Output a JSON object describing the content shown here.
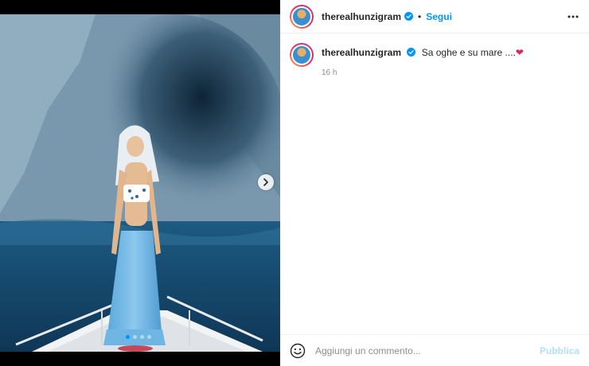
{
  "post": {
    "username": "therealhunzigram",
    "follow_label": "Segui",
    "separator": "•",
    "caption_user": "therealhunzigram",
    "caption_text": "Sa oghe e su mare ....",
    "caption_emoji": "❤",
    "timestamp": "16 h"
  },
  "carousel": {
    "slide_count": 4,
    "active_slide": 1
  },
  "comment": {
    "placeholder": "Aggiungi un commento...",
    "publish_label": "Pubblica"
  },
  "icons": {
    "verified": "verified-badge-icon",
    "more": "more-horizontal-icon",
    "next": "chevron-right-icon",
    "emoji": "emoji-smile-icon"
  },
  "colors": {
    "accent": "#0095f6",
    "publish_disabled": "#b2dffc",
    "muted": "#8e8e8e",
    "heart": "#e0245e"
  }
}
